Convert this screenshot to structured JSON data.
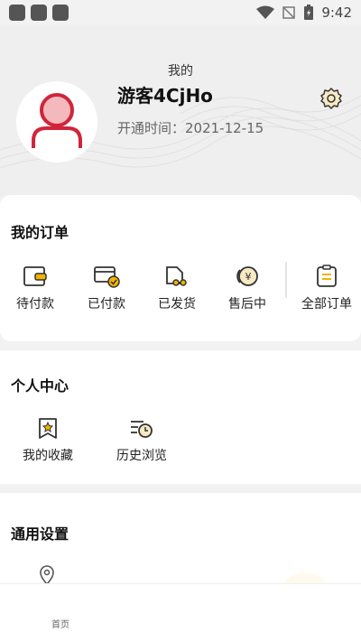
{
  "status_bar": {
    "time": "9:42"
  },
  "header": {
    "title": "我的",
    "username": "游客4CjHo",
    "join_date": "开通时间：2021-12-15"
  },
  "orders": {
    "title": "我的订单",
    "items": [
      {
        "label": "待付款",
        "icon": "wallet-icon"
      },
      {
        "label": "已付款",
        "icon": "card-check-icon"
      },
      {
        "label": "已发货",
        "icon": "truck-icon"
      },
      {
        "label": "售后中",
        "icon": "yuan-coin-icon"
      },
      {
        "label": "全部订单",
        "icon": "list-icon"
      }
    ]
  },
  "personal": {
    "title": "个人中心",
    "items": [
      {
        "label": "我的收藏",
        "icon": "bookmark-star-icon"
      },
      {
        "label": "历史浏览",
        "icon": "history-icon"
      }
    ]
  },
  "settings": {
    "title": "通用设置"
  },
  "bottom_nav": {
    "home_label": "首页",
    "second_label": " "
  },
  "colors": {
    "accent": "#f0b400",
    "avatar_red": "#d0253a",
    "background": "#f2f2f2"
  }
}
